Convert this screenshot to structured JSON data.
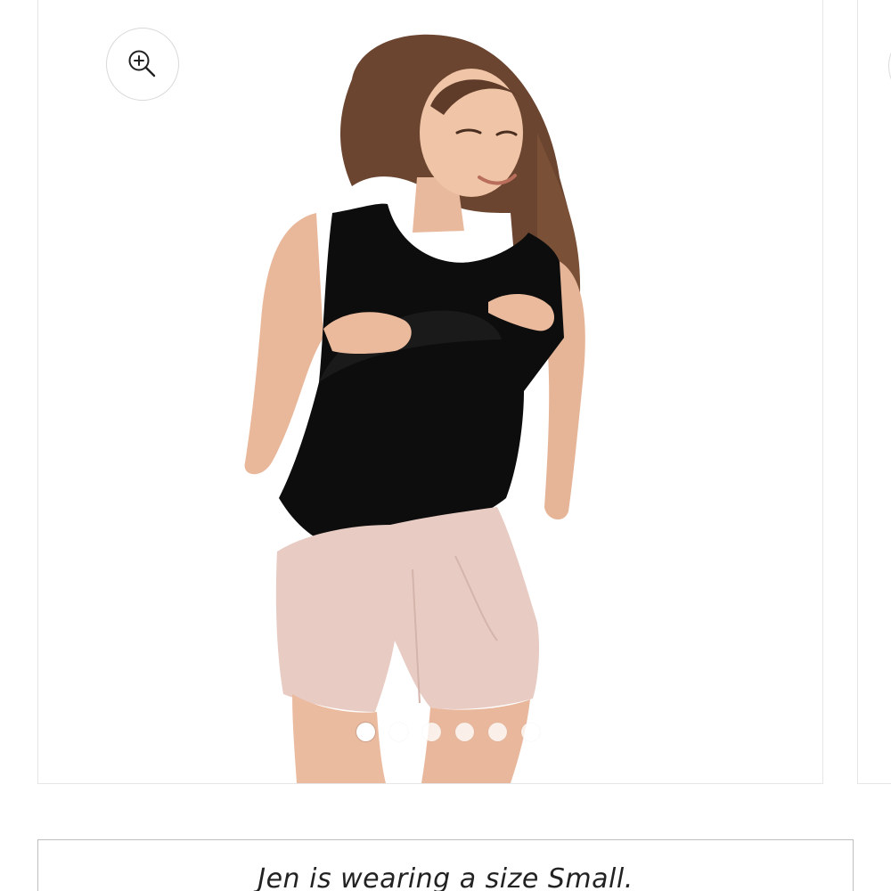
{
  "gallery": {
    "zoom_icon": "zoom-in-icon",
    "image_icon": "product-photo",
    "slide_count": 6,
    "active_slide": 1
  },
  "size_note": {
    "text": "Jen is wearing a size Small."
  },
  "colors": {
    "border": "#e6e6e6",
    "note_border": "#bfbfbf",
    "text": "#222222"
  }
}
